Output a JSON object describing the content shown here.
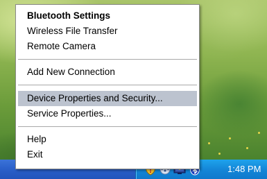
{
  "menu": {
    "items": [
      {
        "label": "Bluetooth Settings"
      },
      {
        "label": "Wireless File Transfer"
      },
      {
        "label": "Remote Camera"
      },
      {
        "label": "Add New Connection"
      },
      {
        "label": "Device Properties and Security..."
      },
      {
        "label": "Service Properties..."
      },
      {
        "label": "Help"
      },
      {
        "label": "Exit"
      }
    ],
    "highlight_color": "#bcc3cf"
  },
  "taskbar": {
    "clock": "1:48 PM",
    "tray_icons": [
      "security-shield-icon",
      "network-icon",
      "wireless-monitor-icon",
      "bluetooth-icon"
    ],
    "colors": {
      "taskbar": "#2a5fc9",
      "tray": "#1487d8"
    }
  }
}
